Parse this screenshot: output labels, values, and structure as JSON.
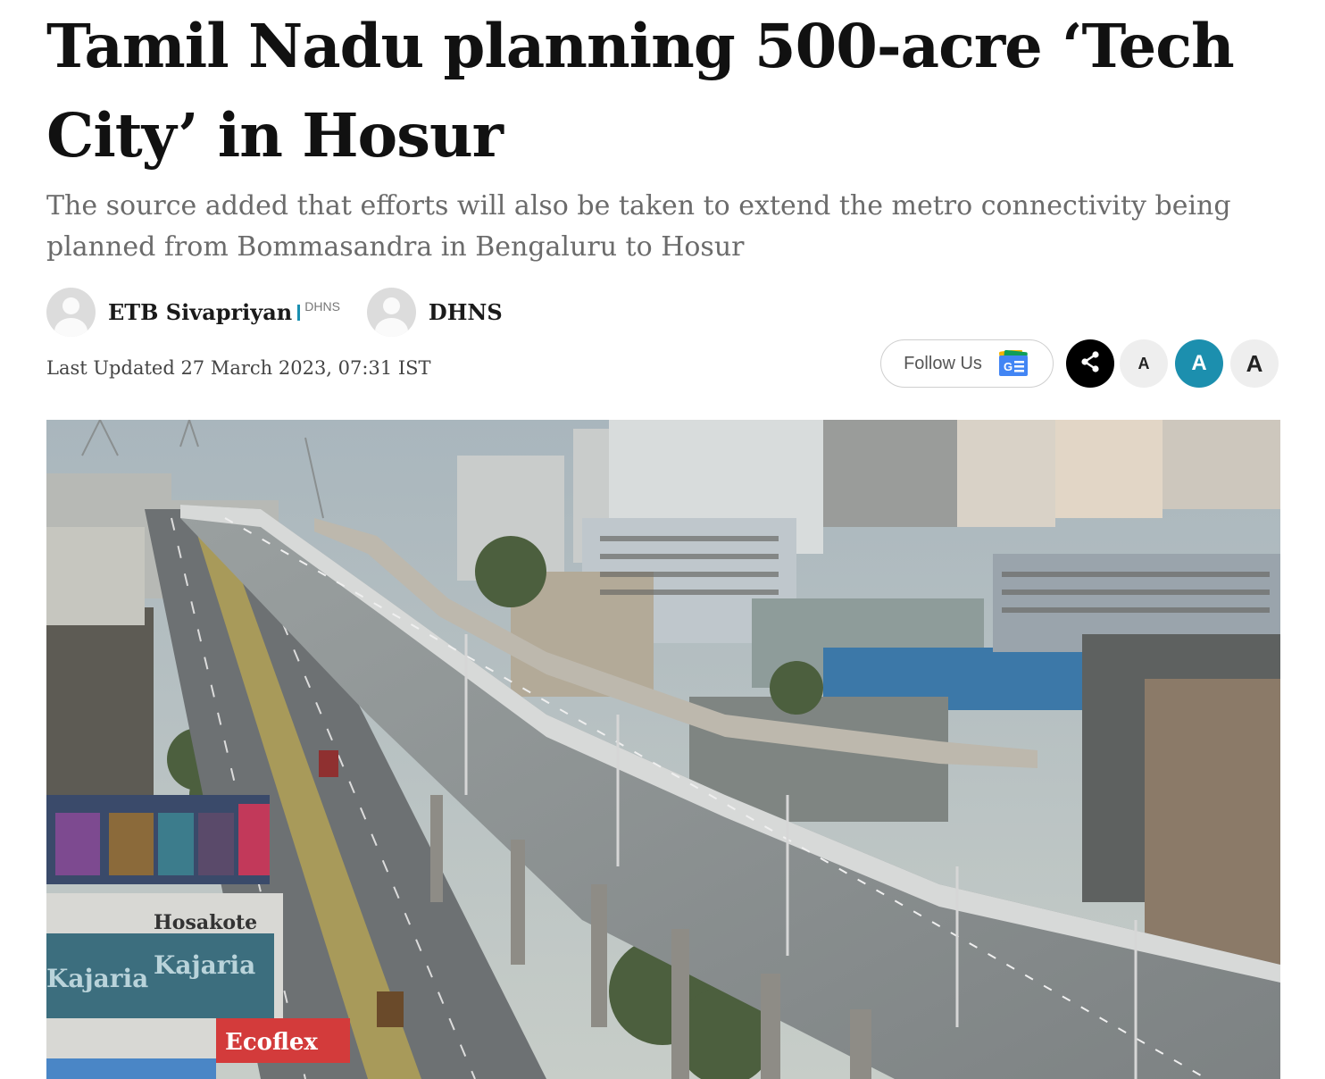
{
  "article": {
    "headline": "Tamil Nadu planning 500-acre ‘Tech City’ in Hosur",
    "summary": "The source added that efforts will also be taken to extend the metro connectivity being planned from Bommasandra in Bengaluru to Hosur",
    "authors": [
      {
        "name": "ETB Sivapriyan",
        "org": "DHNS"
      },
      {
        "name": "DHNS"
      }
    ],
    "last_updated": "Last Updated 27 March 2023, 07:31 IST"
  },
  "actions": {
    "follow_label": "Follow Us",
    "share_icon": "share-icon",
    "font_size_buttons": [
      "A",
      "A",
      "A"
    ],
    "accent_color": "#1c8fae"
  },
  "hero_image": {
    "signage": [
      "Hosakote",
      "Kajaria",
      "Kajaria",
      "Ecoflex"
    ]
  }
}
